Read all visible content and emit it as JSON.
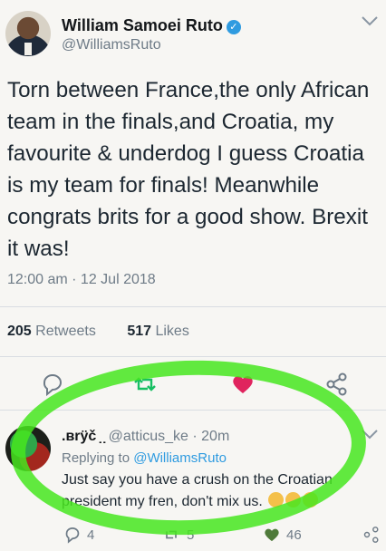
{
  "tweet": {
    "display_name": "William Samoei Ruto",
    "verified_icon": "verified-badge-icon",
    "handle": "@WilliamsRuto",
    "text": "Torn between France,the only African team in the finals,and Croatia, my favourite & underdog I guess Croatia is my team for finals! Meanwhile congrats brits for a good show. Brexit it was!",
    "timestamp": "12:00 am · 12 Jul 2018",
    "retweets_count": "205",
    "retweets_label": "Retweets",
    "likes_count": "517",
    "likes_label": "Likes"
  },
  "actions": [
    "reply-icon",
    "retweet-icon",
    "like-icon",
    "share-icon"
  ],
  "reply": {
    "display_name": ".ʙrÿč ̣ ̣",
    "handle": "@atticus_ke",
    "time": "20m",
    "replying_prefix": "Replying to",
    "replying_to": "@WilliamsRuto",
    "text": "Just say you have a crush on the Croatian president my fren, don't mix us.",
    "emoji_count": 3,
    "reply_count": "4",
    "retweet_count": "5",
    "like_count": "46"
  },
  "colors": {
    "accent_blue": "#2f9be0",
    "retweet_green": "#17bf63",
    "like_red": "#e0245e",
    "highlight_green": "#46e61e"
  }
}
